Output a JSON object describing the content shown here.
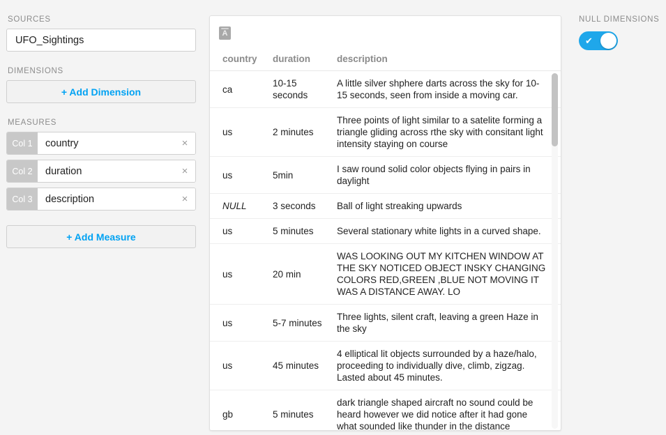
{
  "sidebar": {
    "sources_label": "SOURCES",
    "source_value": "UFO_Sightings",
    "dimensions_label": "DIMENSIONS",
    "add_dimension_label": "+ Add Dimension",
    "measures_label": "MEASURES",
    "add_measure_label": "+ Add Measure",
    "measures": [
      {
        "badge": "Col 1",
        "value": "country",
        "remove_icon": "×"
      },
      {
        "badge": "Col 2",
        "value": "duration",
        "remove_icon": "×"
      },
      {
        "badge": "Col 3",
        "value": "description",
        "remove_icon": "×"
      }
    ]
  },
  "card": {
    "type_icon_letter": "A",
    "columns": [
      "country",
      "duration",
      "description"
    ],
    "rows": [
      {
        "country": "ca",
        "duration": "10-15 seconds",
        "description": "A little silver shphere darts across the sky for 10-15 seconds, seen from inside a moving car."
      },
      {
        "country": "us",
        "duration": "2 minutes",
        "description": "Three points of light similar to a satelite forming a triangle gliding across rthe sky with consitant light intensity staying on course"
      },
      {
        "country": "us",
        "duration": "5min",
        "description": "I saw round solid color objects flying in pairs in daylight"
      },
      {
        "country": "NULL",
        "duration": "3 seconds",
        "description": "Ball of light streaking upwards",
        "is_null": true
      },
      {
        "country": "us",
        "duration": "5 minutes",
        "description": "Several stationary white lights in a curved shape."
      },
      {
        "country": "us",
        "duration": "20 min",
        "description": "WAS LOOKING OUT MY KITCHEN WINDOW AT THE SKY NOTICED OBJECT INSKY CHANGING COLORS RED,GREEN ,BLUE NOT MOVING IT WAS A DISTANCE AWAY. LO"
      },
      {
        "country": "us",
        "duration": "5-7 minutes",
        "description": "Three lights, silent craft, leaving a green Haze in the sky"
      },
      {
        "country": "us",
        "duration": "45 minutes",
        "description": "4 elliptical lit objects surrounded by a haze/halo, proceeding to individually dive, climb, zigzag. Lasted about 45 minutes."
      },
      {
        "country": "gb",
        "duration": "5 minutes",
        "description": "dark triangle shaped aircraft no sound could be heard however we did notice after it had gone what sounded like thunder in the distance"
      }
    ]
  },
  "right_panel": {
    "null_dimensions_label": "NULL DIMENSIONS",
    "toggle_on": true,
    "toggle_check_icon": "✔",
    "toggle_color": "#1fa7ea"
  }
}
